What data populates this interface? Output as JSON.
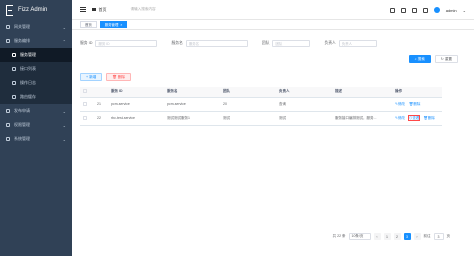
{
  "app": {
    "title": "Fizz Admin"
  },
  "sidebar": {
    "items": [
      {
        "label": "网关管理"
      },
      {
        "label": "服务编排"
      },
      {
        "label": "服务管理"
      },
      {
        "label": "接口列表"
      },
      {
        "label": "操作日志"
      },
      {
        "label": "路由缓存"
      },
      {
        "label": "发布申请"
      },
      {
        "label": "权限管理"
      },
      {
        "label": "系统管理"
      }
    ]
  },
  "navbar": {
    "breadcrumb_home": "首页",
    "search_placeholder": "请输入搜索内容",
    "user": "admin"
  },
  "tags": [
    {
      "label": "首页"
    },
    {
      "label": "服务管理"
    }
  ],
  "filters": {
    "service_id_label": "服务 ID",
    "service_id_placeholder": "服务 ID",
    "service_name_label": "服务名",
    "service_name_placeholder": "服务名",
    "team_label": "团队",
    "team_placeholder": "团队",
    "owner_label": "负责人",
    "owner_placeholder": "负责人",
    "search_btn": "搜索",
    "reset_btn": "重置"
  },
  "toolbar": {
    "add_btn": "新增",
    "delete_btn": "删除"
  },
  "table": {
    "headers": [
      "服务 ID",
      "服务名",
      "团队",
      "负责人",
      "描述",
      "操作"
    ],
    "rows": [
      {
        "no": "21",
        "id": "pcm-service",
        "name": "pcm-service",
        "team": "20",
        "owner": "查询",
        "desc": ""
      },
      {
        "no": "22",
        "id": "rbc-test-service",
        "name": "测试测试服务1",
        "team": "测试",
        "owner": "测试",
        "desc": "服务接口编排测试，服务..."
      }
    ],
    "actions": {
      "edit": "修改",
      "view": "查看",
      "delete": "删除"
    }
  },
  "pager": {
    "total": "共 22 条",
    "page_size": "10条/页",
    "pages": [
      "1",
      "2",
      "3"
    ],
    "current": "3",
    "goto": "前往",
    "goto_value": "3",
    "page_unit": "页"
  },
  "colors": {
    "sidebar": "#304156",
    "primary": "#1890ff",
    "danger": "#ff4949"
  }
}
